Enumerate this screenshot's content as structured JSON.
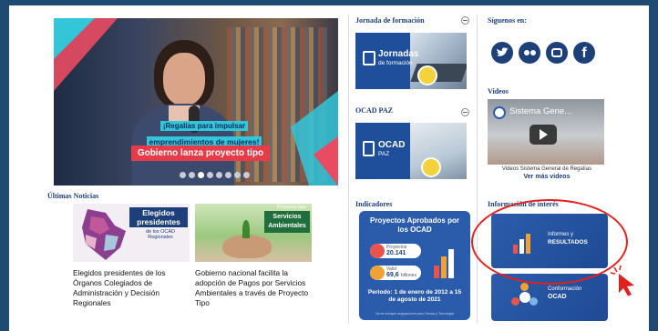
{
  "carousel": {
    "banner_line1": "¡Regalías para impulsar",
    "banner_line2": "emprendimientos de mujeres!",
    "banner_button": "Gobierno lanza proyecto tipo",
    "dots_count": 8,
    "active_dot": 3
  },
  "news": {
    "title": "Últimas Noticias",
    "items": [
      {
        "thumb_title": "Elegidos presidentes",
        "thumb_sub": "de los OCAD Regionales",
        "caption": "Elegidos presidentes de los Órganos Colegiados de Administración y Decisión Regionales"
      },
      {
        "thumb_title": "Servicios Ambientales",
        "thumb_sub": "Proyecto tipo",
        "caption": "Gobierno nacional facilita la adopción de Pagos por Servicios Ambientales a través de Proyecto Tipo"
      }
    ]
  },
  "jornada": {
    "title": "Jornada de formación",
    "card_line1": "Jornadas",
    "card_line2": "de formación"
  },
  "ocad_paz": {
    "title": "OCAD PAZ",
    "card_line1": "OCAD",
    "card_line2": "PAZ"
  },
  "indicadores": {
    "title": "Indicadores",
    "card_title": "Proyectos Aprobados por los OCAD",
    "proyectos_label": "Proyectos",
    "proyectos_value": "20.141",
    "valor_label": "Valor",
    "valor_value": "69,6",
    "valor_unit": "billones",
    "periodo": "Periodo: 1 de enero de 2012 a 15 de agosto de 2021",
    "footnote": "No se incluyen asignaciones para Ciencia y Tecnología"
  },
  "siguenos": {
    "title": "Síguenos en:",
    "icons": [
      "twitter-icon",
      "flickr-icon",
      "youtube-icon",
      "facebook-icon"
    ]
  },
  "videos": {
    "title": "Videos",
    "video_label": "Sistema Gene...",
    "caption": "Videos Sistema General de Regalías",
    "more_link": "Ver más videos"
  },
  "info": {
    "title": "Información de interés",
    "card1_line1": "Informes y",
    "card1_line2": "RESULTADOS",
    "card2_line1": "Conformación",
    "card2_line2": "OCAD"
  },
  "colors": {
    "frame": "#1f4a72",
    "navy": "#1d3f7a",
    "blue_card": "#2b5cab",
    "highlight": "#e0211f",
    "banner_red": "#e63c4a",
    "banner_cyan": "#33c6d9"
  }
}
